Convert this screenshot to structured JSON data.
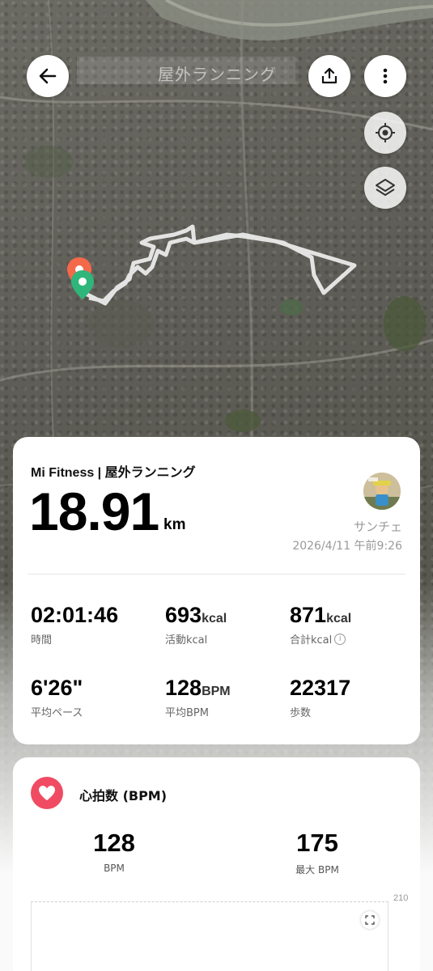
{
  "header": {
    "title": "屋外ランニング",
    "back_icon": "arrow-left-icon",
    "share_icon": "share-icon",
    "more_icon": "more-vertical-icon",
    "locate_icon": "locate-icon",
    "layers_icon": "layers-icon"
  },
  "summary": {
    "app_title": "Mi Fitness | 屋外ランニング",
    "distance": "18.91",
    "distance_unit": "km",
    "user_name": "サンチェ",
    "date_time": "2026/4/11 午前9:26",
    "stats": [
      {
        "value": "02:01:46",
        "unit": "",
        "label": "時間"
      },
      {
        "value": "693",
        "unit": "kcal",
        "label": "活動kcal"
      },
      {
        "value": "871",
        "unit": "kcal",
        "label": "合計kcal"
      },
      {
        "value": "6'26\"",
        "unit": "",
        "label": "平均ペース"
      },
      {
        "value": "128",
        "unit": "BPM",
        "label": "平均BPM"
      },
      {
        "value": "22317",
        "unit": "",
        "label": "歩数"
      }
    ]
  },
  "heart_rate": {
    "title": "心拍数 (BPM)",
    "avg_value": "128",
    "avg_label": "BPM",
    "max_value": "175",
    "max_label": "最大 BPM",
    "axis_max": "210"
  },
  "colors": {
    "accent_red": "#f04b63",
    "start_marker": "#f4694a",
    "end_marker": "#2fb67a",
    "route": "#f2f2f2"
  }
}
